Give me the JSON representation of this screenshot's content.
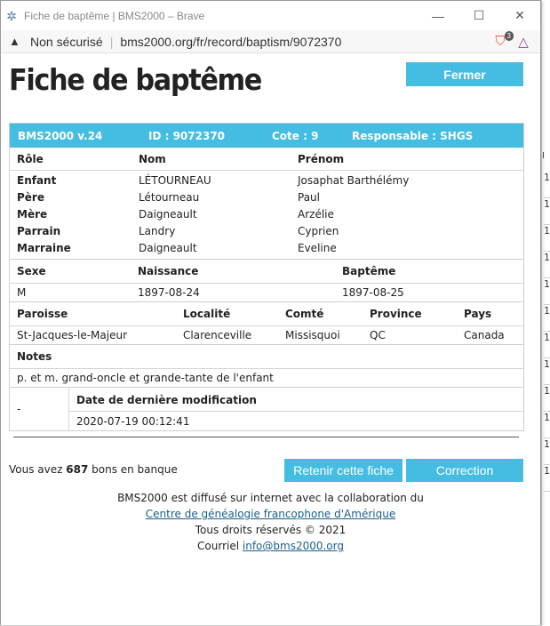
{
  "window": {
    "title": "Fiche de baptême | BMS2000 – Brave",
    "controls": {
      "minimize": "—",
      "maximize": "☐",
      "close": "✕"
    }
  },
  "address": {
    "security_label": "Non sécurisé",
    "url": "bms2000.org/fr/record/baptism/9072370",
    "brave_badge": "3"
  },
  "page": {
    "heading": "Fiche de baptême",
    "close_label": "Fermer"
  },
  "record": {
    "header": {
      "version": "BMS2000 v.24",
      "id": "ID : 9072370",
      "cote": "Cote : 9",
      "responsable": "Responsable : SHGS"
    },
    "persons": {
      "columns": [
        "Rôle",
        "Nom",
        "Prénom"
      ],
      "rows": [
        {
          "role": "Enfant",
          "nom": "LÉTOURNEAU",
          "prenom": "Josaphat Barthélémy"
        },
        {
          "role": "Père",
          "nom": "Létourneau",
          "prenom": "Paul"
        },
        {
          "role": "Mère",
          "nom": "Daigneault",
          "prenom": "Arzélie"
        },
        {
          "role": "Parrain",
          "nom": "Landry",
          "prenom": "Cyprien"
        },
        {
          "role": "Marraine",
          "nom": "Daigneault",
          "prenom": "Eveline"
        }
      ]
    },
    "dates": {
      "columns": [
        "Sexe",
        "Naissance",
        "Baptême"
      ],
      "values": [
        "M",
        "1897-08-24",
        "1897-08-25"
      ]
    },
    "place": {
      "columns": [
        "Paroisse",
        "Localité",
        "Comté",
        "Province",
        "Pays"
      ],
      "values": [
        "St-Jacques-le-Majeur",
        "Clarenceville",
        "Missisquoi",
        "QC",
        "Canada"
      ]
    },
    "notes": {
      "label": "Notes",
      "text": "p. et m. grand-oncle et grande-tante de l'enfant"
    },
    "modification": {
      "dash": "-",
      "label": "Date de dernière modification",
      "value": "2020-07-19 00:12:41"
    }
  },
  "bank": {
    "prefix": "Vous avez ",
    "count": "687",
    "suffix": " bons en banque"
  },
  "actions": {
    "keep_label": "Retenir cette fiche",
    "correction_label": "Correction"
  },
  "footer": {
    "line1": "BMS2000 est diffusé sur internet avec la collaboration du",
    "link": "Centre de généalogie francophone d'Amérique",
    "rights": "Tous droits réservés © 2021",
    "email_prefix": "Courriel ",
    "email": "info@bms2000.org"
  },
  "background": {
    "header_char": "I",
    "row_chars": [
      "1",
      "1",
      "1",
      "1",
      "1",
      "1",
      "1",
      "1",
      "1",
      "1",
      "1",
      "1"
    ]
  },
  "colors": {
    "accent": "#45bde3",
    "link": "#1a5f8a"
  }
}
